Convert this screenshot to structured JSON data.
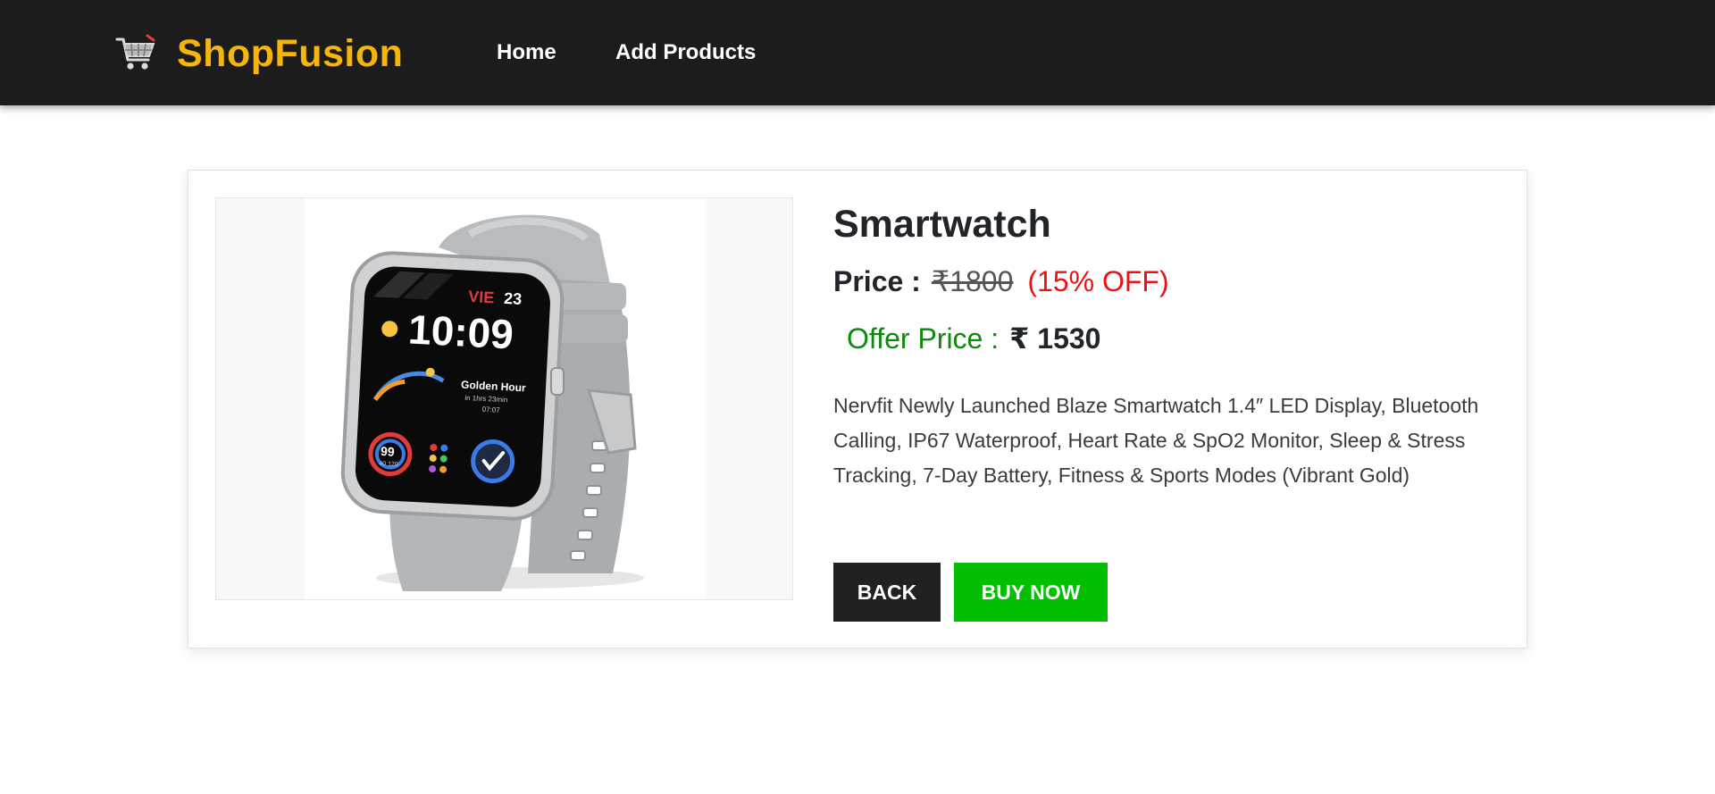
{
  "navbar": {
    "brand_name": "ShopFusion",
    "brand_icon": "shopping-cart-icon",
    "links": [
      {
        "label": "Home"
      },
      {
        "label": "Add Products"
      }
    ],
    "colors": {
      "background": "#1c1c1c",
      "brand": "#f5b50a",
      "link": "#ffffff"
    }
  },
  "product": {
    "image_alt": "Smartwatch",
    "title": "Smartwatch",
    "price_label": "Price :",
    "original_price": "₹1800",
    "discount_text": "(15% OFF)",
    "offer_label": "Offer Price :",
    "offer_price": "₹ 1530",
    "description": "Nervfit Newly Launched Blaze Smartwatch 1.4″ LED Display, Bluetooth Calling, IP67 Waterproof, Heart Rate & SpO2 Monitor, Sleep & Stress Tracking, 7-Day Battery, Fitness & Sports Modes (Vibrant Gold)",
    "watch_face": {
      "day_text": "VIE",
      "date_text": "23",
      "time_text": "10:09",
      "widget_title": "Golden Hour",
      "widget_sub": "in 1hrs 23min",
      "widget_time": "07:07",
      "ring_value": "99",
      "ring_sub": "40 120"
    }
  },
  "actions": {
    "back_label": "BACK",
    "buy_label": "BUY NOW"
  },
  "colors": {
    "discount": "#ee1111",
    "offer_label": "#0b8a0b",
    "back_button": "#212121",
    "buy_button": "#04be04"
  }
}
